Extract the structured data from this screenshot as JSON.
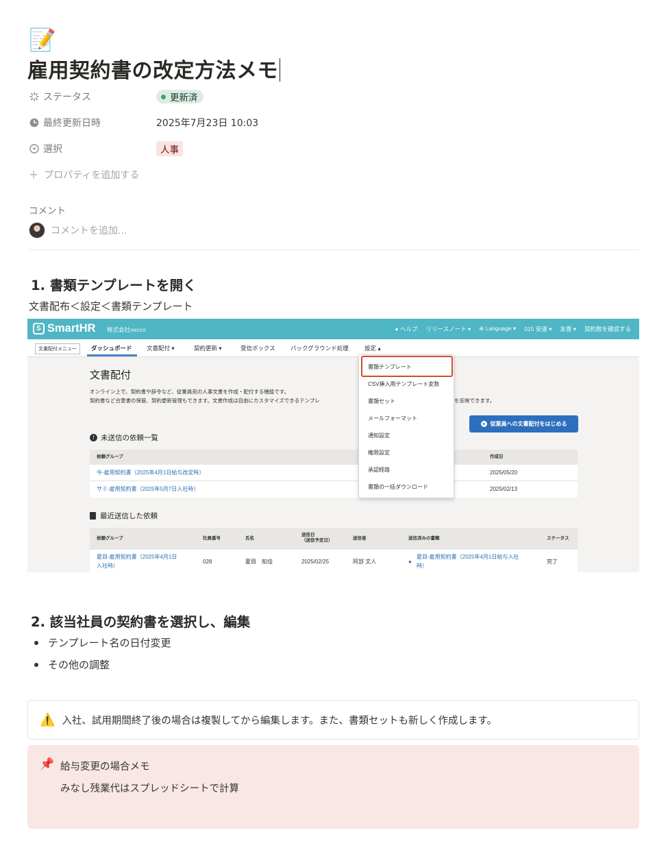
{
  "page": {
    "icon": "📝",
    "title": "雇用契約書の改定方法メモ"
  },
  "properties": [
    {
      "icon": "status-icon",
      "label": "ステータス",
      "value": "更新済",
      "color": "#dbede3"
    },
    {
      "icon": "clock-icon",
      "label": "最終更新日時",
      "value": "2025年7月23日 10:03"
    },
    {
      "icon": "select-icon",
      "label": "選択",
      "value": "人事",
      "color": "#fbe3e1"
    }
  ],
  "add_property": "プロパティを追加する",
  "comments": {
    "heading": "コメント",
    "placeholder": "コメントを追加..."
  },
  "section1": {
    "heading": "1. 書類テンプレートを開く",
    "text": "文書配布＜設定＜書類テンプレート"
  },
  "screenshot": {
    "brand": "SmartHR",
    "company": "株式会社necco",
    "topnav": [
      "ヘルプ",
      "リリースノート ▾",
      "Language ▾",
      "015 安達 ▾",
      "友香 ▾",
      "契約数を確認する"
    ],
    "menu_button": "文書配付メニュー",
    "tabs": [
      "ダッシュボード",
      "文書配付 ▾",
      "契約更新 ▾",
      "受信ボックス",
      "バックグラウンド処理",
      "設定 ▴"
    ],
    "title": "文書配付",
    "desc1": "オンライン上で、契約書や辞令など、従業員宛の人事文書を作成・配付する機能です。",
    "desc2": "契約書など合意書の保管、契約更新管理もできます。文書作成は自由にカスタマイズできるテンプレ",
    "desc2_tail": "を反映できます。",
    "cta": "従業員への文書配付をはじめる",
    "pending": {
      "heading": "未送信の依頼一覧",
      "col_group": "依頼グループ",
      "col_date": "作成日",
      "rows": [
        {
          "group": "今-雇用契約書（2025年4月1日給与改定時）",
          "date": "2025/05/20"
        },
        {
          "group": "サミ-雇用契約書（2025年5月7日入社時）",
          "date": "2025/02/13"
        }
      ]
    },
    "recent": {
      "heading": "最近送信した依頼",
      "cols": [
        "依頼グループ",
        "社員番号",
        "氏名",
        "送信日\n（送信予定日）",
        "送信者",
        "送信済みの書類",
        "ステータス"
      ],
      "row": {
        "group1": "夏目-雇用契約書（2025年4月1日",
        "group2": "入社時）",
        "emp_no": "028",
        "name": "夏目　知佳",
        "date": "2025/02/25",
        "sender": "阿部 文人",
        "doc1": "夏目-雇用契約書（2025年4月1日給与入社",
        "doc2": "時）",
        "status": "完了"
      }
    },
    "dropdown": [
      "書類テンプレート",
      "CSV挿入用テンプレート変数",
      "書類セット",
      "メールフォーマット",
      "通知設定",
      "権限設定",
      "承認経路",
      "書類の一括ダウンロード"
    ],
    "colors": {
      "header": "#4fb6c5",
      "highlight": "#d3482f",
      "cta": "#2c6fbf"
    }
  },
  "section2": {
    "heading": "2. 該当社員の契約書を選択し、編集",
    "bullets": [
      "テンプレート名の日付変更",
      "その他の調整"
    ]
  },
  "callout_warning": {
    "icon": "⚠️",
    "text": "入社、試用期間終了後の場合は複製してから編集します。また、書類セットも新しく作成します。"
  },
  "callout_note": {
    "icon": "📌",
    "title": "給与変更の場合メモ",
    "text": "みなし残業代はスプレッドシートで計算"
  }
}
